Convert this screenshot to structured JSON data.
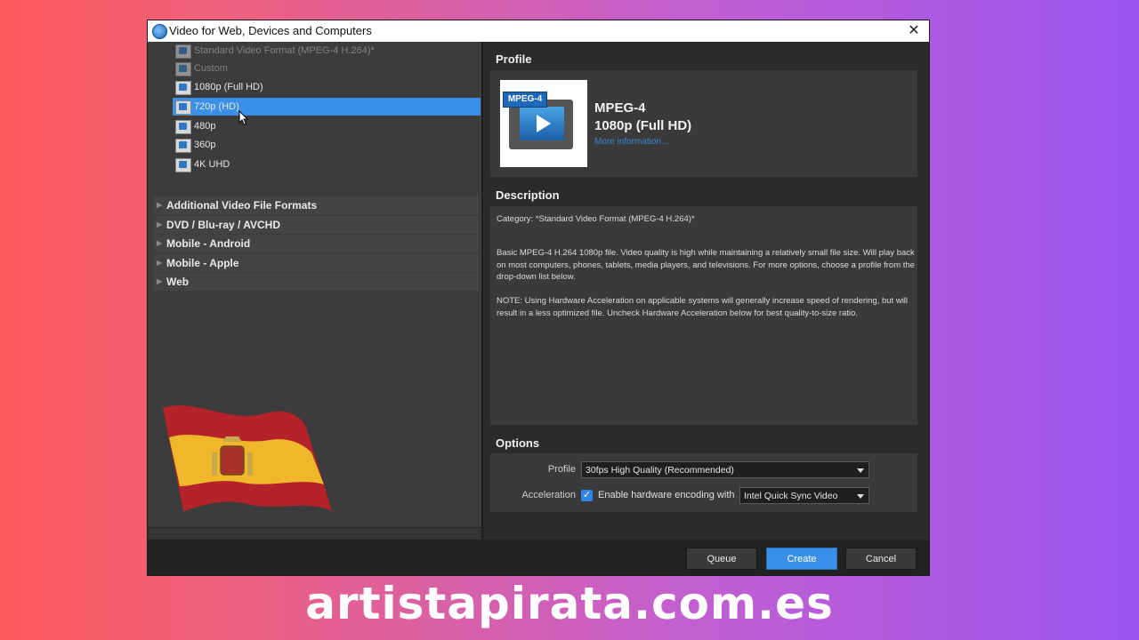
{
  "window": {
    "title": "Video for Web, Devices and Computers"
  },
  "left_panel": {
    "tree_items": [
      {
        "label": "Standard Video Format (MPEG-4 H.264)*",
        "state": "faded"
      },
      {
        "label": "Custom",
        "state": "faded"
      },
      {
        "label": "1080p (Full HD)",
        "state": "normal"
      },
      {
        "label": "720p (HD)",
        "state": "selected"
      },
      {
        "label": "480p",
        "state": "normal"
      },
      {
        "label": "360p",
        "state": "normal"
      },
      {
        "label": "4K UHD",
        "state": "normal"
      }
    ],
    "categories": [
      "Additional Video File Formats",
      "DVD / Blu-ray / AVCHD",
      "Mobile - Android",
      "Mobile - Apple",
      "Web"
    ],
    "footer": {
      "add": "add",
      "remove": "remove",
      "edit": "edit"
    }
  },
  "right_panel": {
    "profile_heading": "Profile",
    "profile": {
      "badge": "MPEG-4",
      "name": "MPEG-4",
      "resolution": "1080p (Full HD)",
      "more_link": "More information..."
    },
    "description_heading": "Description",
    "description": {
      "category": "Category: *Standard Video Format (MPEG-4 H.264)*",
      "body": "Basic MPEG-4 H.264 1080p file. Video quality is high while maintaining a relatively small file size. Will play back on most computers, phones, tablets, media players, and televisions. For more options, choose a profile from the drop-down list below.",
      "note": "NOTE: Using Hardware Acceleration on applicable systems will generally increase speed of rendering, but will result in a less optimized file. Uncheck Hardware Acceleration below for best quality-to-size ratio."
    },
    "options_heading": "Options",
    "options": {
      "profile_label": "Profile",
      "profile_value": "30fps High Quality (Recommended)",
      "acceleration_label": "Acceleration",
      "acceleration_checkbox": "Enable hardware encoding with",
      "acceleration_checked": true,
      "acceleration_value": "Intel Quick Sync Video"
    }
  },
  "buttons": {
    "queue": "Queue",
    "create": "Create",
    "cancel": "Cancel"
  },
  "watermark": "artistapirata.com.es",
  "colors": {
    "accent": "#3a8fe8",
    "panel": "#3a3a3a",
    "background": "#2b2b2b"
  }
}
